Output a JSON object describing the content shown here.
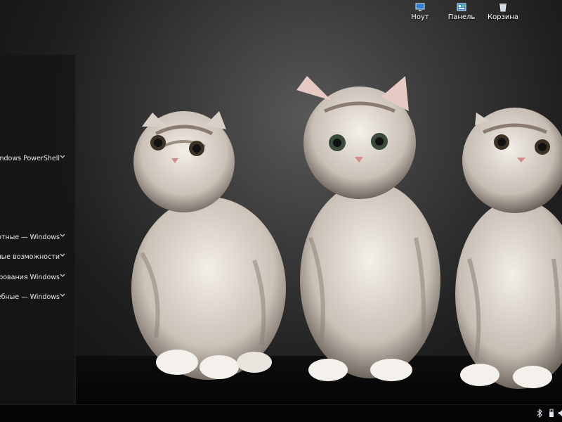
{
  "desktop": {
    "icons": [
      {
        "label": "Ноут",
        "icon": "computer-icon"
      },
      {
        "label": "Панель",
        "icon": "control-panel-icon"
      },
      {
        "label": "Корзина",
        "icon": "recycle-bin-icon"
      }
    ]
  },
  "start_menu": {
    "items": [
      {
        "label": "Windows PowerShell"
      },
      {
        "label": "Стандартные — Windows"
      },
      {
        "label": "Специальные возможности"
      },
      {
        "label": "Средства администрирования Windows"
      },
      {
        "label": "Служебные — Windows"
      }
    ]
  },
  "taskbar": {
    "tray": [
      {
        "icon": "bluetooth-icon"
      },
      {
        "icon": "usb-device-icon"
      },
      {
        "icon": "speaker-icon"
      }
    ]
  },
  "colors": {
    "panel": "#161618",
    "taskbar": "#050505",
    "text": "#e8e8e8"
  }
}
